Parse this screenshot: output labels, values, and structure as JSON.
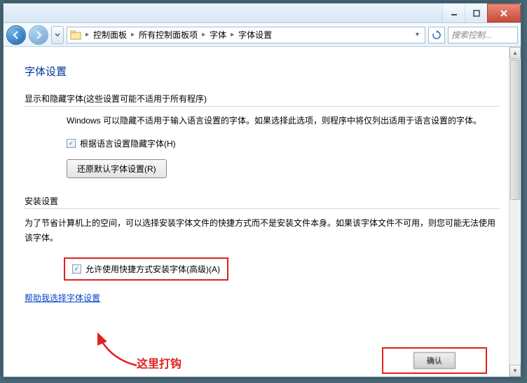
{
  "title_buttons": {
    "min": "minimize",
    "max": "maximize",
    "close": "close"
  },
  "breadcrumb": {
    "items": [
      "控制面板",
      "所有控制面板项",
      "字体",
      "字体设置"
    ]
  },
  "search": {
    "placeholder": "搜索控制..."
  },
  "page": {
    "heading": "字体设置",
    "section1": {
      "title": "显示和隐藏字体(这些设置可能不适用于所有程序)",
      "desc": "Windows 可以隐藏不适用于输入语言设置的字体。如果选择此选项，则程序中将仅列出适用于语言设置的字体。",
      "checkbox": "根据语言设置隐藏字体(H)",
      "button": "还原默认字体设置(R)"
    },
    "section2": {
      "title": "安装设置",
      "desc": "为了节省计算机上的空间，可以选择安装字体文件的快捷方式而不是安装文件本身。如果该字体文件不可用，则您可能无法使用该字体。",
      "checkbox": "允许使用快捷方式安装字体(高级)(A)"
    },
    "help_link": "帮助我选择字体设置"
  },
  "annotation": "这里打钩",
  "bottom_button": "确认"
}
